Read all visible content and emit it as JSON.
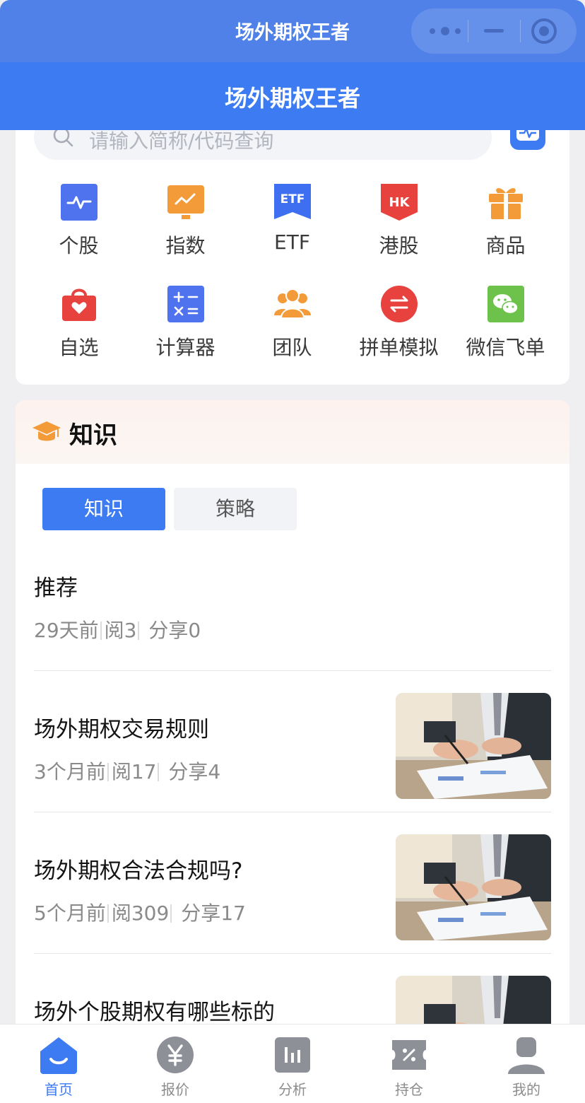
{
  "app": {
    "mini_title": "场外期权王者",
    "nav_title": "场外期权王者"
  },
  "search": {
    "placeholder": "请输入简称/代码查询"
  },
  "grid": [
    {
      "label": "个股",
      "icon": "stock-pulse-icon",
      "color": "#4f73ee"
    },
    {
      "label": "指数",
      "icon": "index-chart-icon",
      "color": "#f29b38"
    },
    {
      "label": "ETF",
      "icon": "etf-badge-icon",
      "color": "#3d6ff0"
    },
    {
      "label": "港股",
      "icon": "hk-badge-icon",
      "color": "#e8423f"
    },
    {
      "label": "商品",
      "icon": "gift-icon",
      "color": "#f29b38"
    },
    {
      "label": "自选",
      "icon": "favorite-bag-icon",
      "color": "#e8423f"
    },
    {
      "label": "计算器",
      "icon": "calculator-icon",
      "color": "#4f73ee"
    },
    {
      "label": "团队",
      "icon": "team-icon",
      "color": "#f29b38"
    },
    {
      "label": "拼单模拟",
      "icon": "exchange-icon",
      "color": "#e8423f"
    },
    {
      "label": "微信飞单",
      "icon": "wechat-icon",
      "color": "#6cc24a"
    }
  ],
  "knowledge": {
    "title": "知识",
    "tabs": [
      {
        "label": "知识",
        "active": true
      },
      {
        "label": "策略",
        "active": false
      }
    ],
    "articles": [
      {
        "title": "推荐",
        "time": "29天前",
        "reads": "阅3",
        "shares": "分享0",
        "has_thumb": false
      },
      {
        "title": "场外期权交易规则",
        "time": "3个月前",
        "reads": "阅17",
        "shares": "分享4",
        "has_thumb": true
      },
      {
        "title": "场外期权合法合规吗?",
        "time": "5个月前",
        "reads": "阅309",
        "shares": "分享17",
        "has_thumb": true
      },
      {
        "title": "场外个股期权有哪些标的",
        "time": "",
        "reads": "",
        "shares": "",
        "has_thumb": true
      }
    ]
  },
  "tabbar": [
    {
      "label": "首页",
      "icon": "home-icon",
      "active": true
    },
    {
      "label": "报价",
      "icon": "yen-icon",
      "active": false
    },
    {
      "label": "分析",
      "icon": "analysis-icon",
      "active": false
    },
    {
      "label": "持仓",
      "icon": "position-ticket-icon",
      "active": false
    },
    {
      "label": "我的",
      "icon": "profile-icon",
      "active": false
    }
  ],
  "colors": {
    "primary": "#3d7bf2",
    "mini_bar": "#4f81e8"
  }
}
